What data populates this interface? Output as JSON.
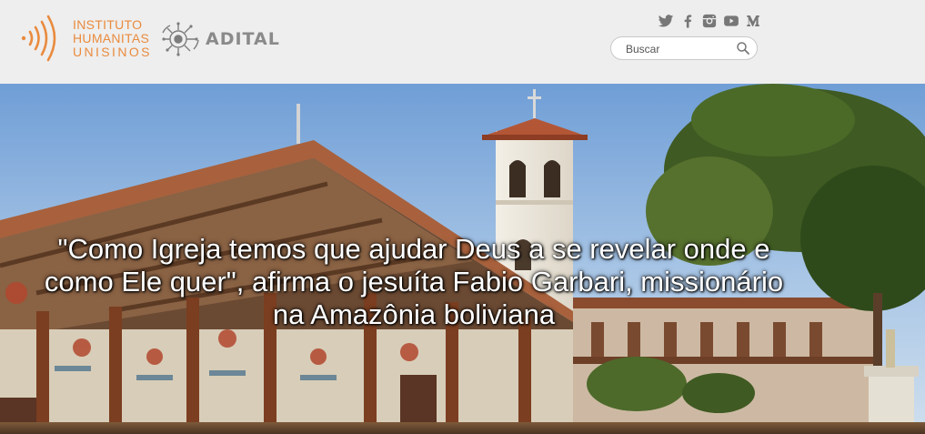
{
  "header": {
    "logo_ihu_lines": [
      "INSTITUTO",
      "HUMANITAS",
      "UNISINOS"
    ],
    "logo_adital": "ADITAL",
    "social_icons": [
      "twitter-icon",
      "facebook-icon",
      "instagram-icon",
      "youtube-icon",
      "medium-icon"
    ],
    "search": {
      "placeholder": "Buscar",
      "value": ""
    }
  },
  "colors": {
    "brand_orange": "#e98b3e",
    "header_bg": "#eeeeee",
    "adital_gray": "#8a8a8a",
    "social_gray": "#777777"
  },
  "hero": {
    "headline": "\"Como Igreja temos que ajudar Deus a se revelar onde e como Ele quer\", afirma o jesuíta Fabio Garbari, missionário na Amazônia boliviana"
  }
}
